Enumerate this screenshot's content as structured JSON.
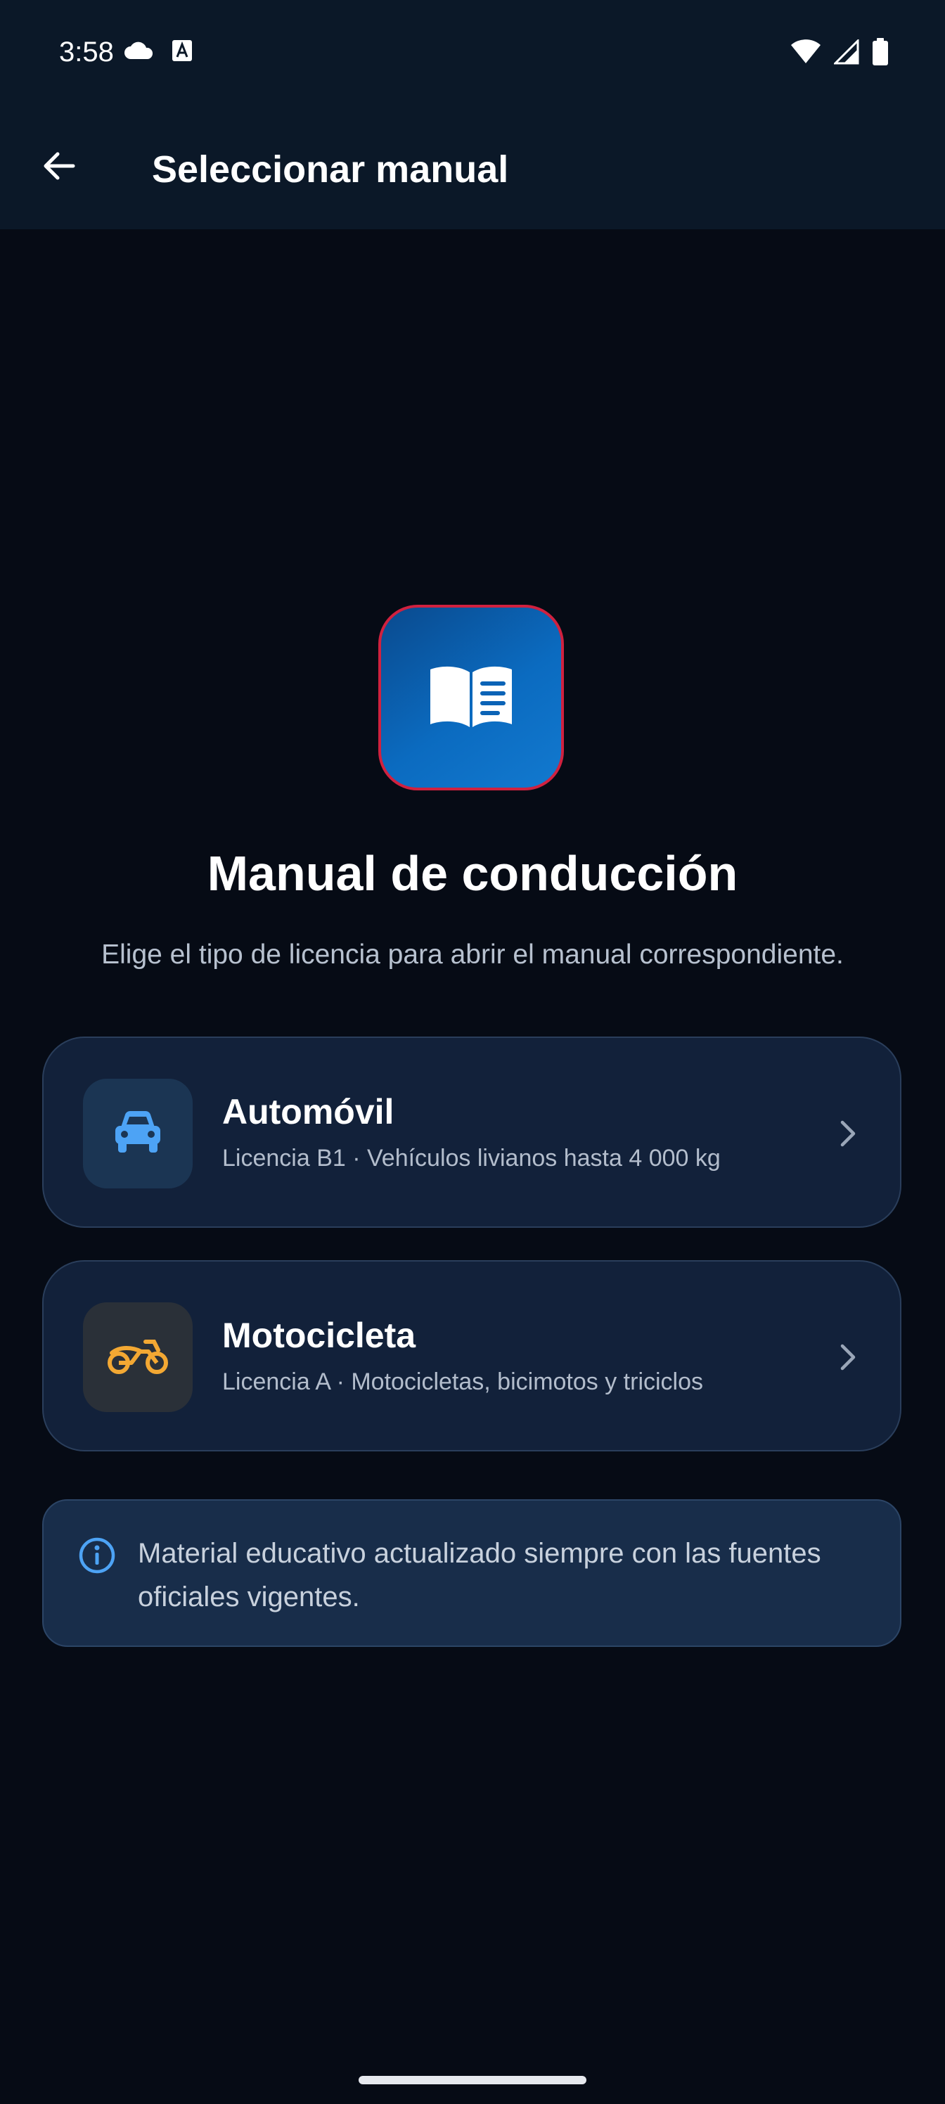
{
  "status_bar": {
    "time": "3:58",
    "left_icons": [
      "cloud-icon",
      "font-a-icon"
    ],
    "right_icons": [
      "wifi-icon",
      "signal-icon",
      "battery-icon"
    ]
  },
  "app_bar": {
    "back_icon": "arrow-left-icon",
    "title": "Seleccionar manual"
  },
  "hero": {
    "icon": "open-book-icon",
    "title": "Manual de conducción",
    "subtitle": "Elige el tipo de licencia para abrir el manual correspondiente."
  },
  "options": [
    {
      "icon": "car-icon",
      "icon_color": "#4da3f5",
      "title": "Automóvil",
      "subtitle": "Licencia B1 · Vehículos livianos hasta 4 000 kg"
    },
    {
      "icon": "motorcycle-icon",
      "icon_color": "#f3a833",
      "title": "Motocicleta",
      "subtitle": "Licencia A · Motocicletas, bicimotos y triciclos"
    }
  ],
  "info": {
    "icon": "info-icon",
    "text": "Material educativo actualizado siempre con las fuentes oficiales vigentes."
  },
  "colors": {
    "background": "#060b15",
    "app_bar": "#0b1828",
    "card": "#12213a",
    "accent_blue": "#0b6bc0",
    "hero_border": "#d0213f"
  }
}
